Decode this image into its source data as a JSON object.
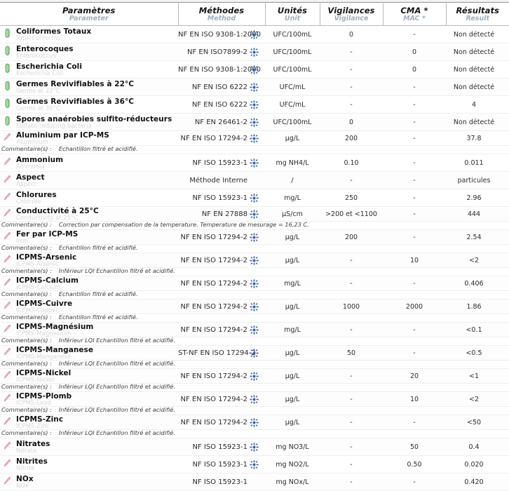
{
  "header": {
    "columns": [
      {
        "fr": "Paramètres",
        "en": "Parameter"
      },
      {
        "fr": "Méthodes",
        "en": "Method"
      },
      {
        "fr": "Unités",
        "en": "Unit"
      },
      {
        "fr": "Vigilances",
        "en": "Vigilance"
      },
      {
        "fr": "CMA *",
        "en": "MAC *"
      },
      {
        "fr": "Résultats",
        "en": "Result"
      }
    ]
  },
  "comment_label": "Commentaire(s) :",
  "icons": {
    "microbio": "bacteria-capsule-icon",
    "chemistry": "chemistry-flask-icon",
    "accredited": "accreditation-cofrac-icon"
  },
  "colors": {
    "microbio": "#7ec07a",
    "chemistry": "#e8a9b8",
    "accredited": "#3f63a8",
    "subtitle": "#a8bac7",
    "english_param": "#dcdcdc"
  },
  "rows": [
    {
      "type": "microbio",
      "fr": "Coliformes Totaux",
      "en": "Total Coliforms",
      "method": "NF EN ISO 9308-1:2000",
      "accredited": true,
      "unit": "UFC/100mL",
      "vigilance": "0",
      "cma": "-",
      "result": "Non détecté",
      "comment": null
    },
    {
      "type": "microbio",
      "fr": "Enterocoques",
      "en": "Enterococcus",
      "method": "NF EN ISO7899-2",
      "accredited": true,
      "unit": "UFC/100mL",
      "vigilance": "-",
      "cma": "0",
      "result": "Non détecté",
      "comment": null
    },
    {
      "type": "microbio",
      "fr": "Escherichia Coli",
      "en": "Escherichia Coli",
      "method": "NF EN ISO 9308-1:2000",
      "accredited": true,
      "unit": "UFC/100mL",
      "vigilance": "-",
      "cma": "0",
      "result": "Non détecté",
      "comment": null
    },
    {
      "type": "microbio",
      "fr": "Germes Revivifiables à 22°C",
      "en": "Germs at 22°C",
      "method": "NF EN ISO 6222",
      "accredited": true,
      "unit": "UFC/mL",
      "vigilance": "-",
      "cma": "-",
      "result": "Non détecté",
      "comment": null
    },
    {
      "type": "microbio",
      "fr": "Germes Revivifiables à 36°C",
      "en": "Germs at 36°C",
      "method": "NF EN ISO 6222",
      "accredited": true,
      "unit": "UFC/mL",
      "vigilance": "-",
      "cma": "-",
      "result": "4",
      "comment": null
    },
    {
      "type": "microbio",
      "fr": "Spores anaérobies sulfito-réducteurs",
      "en": "Sulfate-reducing bacteria",
      "method": "NF EN 26461-2",
      "accredited": true,
      "unit": "UFC/100mL",
      "vigilance": "0",
      "cma": "-",
      "result": "Non détecté",
      "comment": null
    },
    {
      "type": "chemistry",
      "fr": "Aluminium par ICP-MS",
      "en": "Aluminium",
      "method": "NF EN ISO 17294-2",
      "accredited": true,
      "unit": "µg/L",
      "vigilance": "200",
      "cma": "-",
      "result": "37.8",
      "comment": "Echantillon filtré et acidifié."
    },
    {
      "type": "chemistry",
      "fr": "Ammonium",
      "en": "Ammonia",
      "method": "NF ISO 15923-1",
      "accredited": true,
      "unit": "mg NH4/L",
      "vigilance": "0.10",
      "cma": "-",
      "result": "0.011",
      "comment": null
    },
    {
      "type": "chemistry",
      "fr": "Aspect",
      "en": "Aspect",
      "method": "Méthode Interne",
      "accredited": false,
      "unit": "/",
      "vigilance": "-",
      "cma": "-",
      "result": "particules",
      "comment": null
    },
    {
      "type": "chemistry",
      "fr": "Chlorures",
      "en": "Chloride",
      "method": "NF ISO 15923-1",
      "accredited": true,
      "unit": "mg/L",
      "vigilance": "250",
      "cma": "-",
      "result": "2.96",
      "comment": null
    },
    {
      "type": "chemistry",
      "fr": "Conductivité à 25°C",
      "en": "Conductivity at 25°C",
      "method": "NF EN 27888",
      "accredited": true,
      "unit": "µS/cm",
      "vigilance": ">200 et <1100",
      "cma": "-",
      "result": "444",
      "comment": "Correction par compensation de la temperature. Temperature de mesurage = 16,23 C."
    },
    {
      "type": "chemistry",
      "fr": "Fer par ICP-MS",
      "en": "Iron",
      "method": "NF EN ISO 17294-2",
      "accredited": true,
      "unit": "µg/L",
      "vigilance": "200",
      "cma": "-",
      "result": "2.54",
      "comment": "Echantillon filtré et acidifié."
    },
    {
      "type": "chemistry",
      "fr": "ICPMS-Arsenic",
      "en": "ICPMS-Arsenic",
      "method": "NF EN ISO 17294-2",
      "accredited": true,
      "unit": "µg/L",
      "vigilance": "-",
      "cma": "10",
      "result": "<2",
      "comment": "Inférieur LQI Echantillon filtré et acidifié."
    },
    {
      "type": "chemistry",
      "fr": "ICPMS-Calcium",
      "en": "ICPMS-Calcium",
      "method": "NF EN ISO 17294-2",
      "accredited": true,
      "unit": "mg/L",
      "vigilance": "-",
      "cma": "-",
      "result": "0.406",
      "comment": "Echantillon filtré et acidifié."
    },
    {
      "type": "chemistry",
      "fr": "ICPMS-Cuivre",
      "en": "ICPMS-Copper",
      "method": "NF EN ISO 17294-2",
      "accredited": true,
      "unit": "µg/L",
      "vigilance": "1000",
      "cma": "2000",
      "result": "1.86",
      "comment": "Echantillon filtré et acidifié."
    },
    {
      "type": "chemistry",
      "fr": "ICPMS-Magnésium",
      "en": "ICPMS-Magnesium",
      "method": "NF EN ISO 17294-2",
      "accredited": true,
      "unit": "mg/L",
      "vigilance": "-",
      "cma": "-",
      "result": "<0.1",
      "comment": "Inférieur LQI Echantillon filtré et acidifié."
    },
    {
      "type": "chemistry",
      "fr": "ICPMS-Manganese",
      "en": "ICPMS-Manganese",
      "method": "ST-NF EN ISO 17294-2",
      "accredited": true,
      "unit": "µg/L",
      "vigilance": "50",
      "cma": "-",
      "result": "<0.5",
      "comment": "Inférieur LQI Echantillon filtré et acidifié."
    },
    {
      "type": "chemistry",
      "fr": "ICPMS-Nickel",
      "en": "ICPMS-Nickel",
      "method": "NF EN ISO 17294-2",
      "accredited": true,
      "unit": "µg/L",
      "vigilance": "-",
      "cma": "20",
      "result": "<1",
      "comment": "Inférieur LQI Echantillon filtré et acidifié."
    },
    {
      "type": "chemistry",
      "fr": "ICPMS-Plomb",
      "en": "ICPMS-Lead",
      "method": "NF EN ISO 17294-2",
      "accredited": true,
      "unit": "µg/L",
      "vigilance": "-",
      "cma": "10",
      "result": "<2",
      "comment": "Inférieur LQI Echantillon filtré et acidifié."
    },
    {
      "type": "chemistry",
      "fr": "ICPMS-Zinc",
      "en": "ICPMS-Zinc",
      "method": "NF EN ISO 17294-2",
      "accredited": true,
      "unit": "µg/L",
      "vigilance": "-",
      "cma": "-",
      "result": "<50",
      "comment": "Inférieur LQI Echantillon filtré et acidifié."
    },
    {
      "type": "chemistry",
      "fr": "Nitrates",
      "en": "Nitrate",
      "method": "NF ISO 15923-1",
      "accredited": true,
      "unit": "mg NO3/L",
      "vigilance": "-",
      "cma": "50",
      "result": "0.4",
      "comment": null
    },
    {
      "type": "chemistry",
      "fr": "Nitrites",
      "en": "Nitrite",
      "method": "NF ISO 15923-1",
      "accredited": true,
      "unit": "mg NO2/L",
      "vigilance": "-",
      "cma": "0.50",
      "result": "0.020",
      "comment": null
    },
    {
      "type": "chemistry",
      "fr": "NOx",
      "en": "NOx",
      "method": "NF ISO 15923-1",
      "accredited": false,
      "unit": "mg NOx/L",
      "vigilance": "-",
      "cma": "-",
      "result": "0.420",
      "comment": null
    }
  ]
}
